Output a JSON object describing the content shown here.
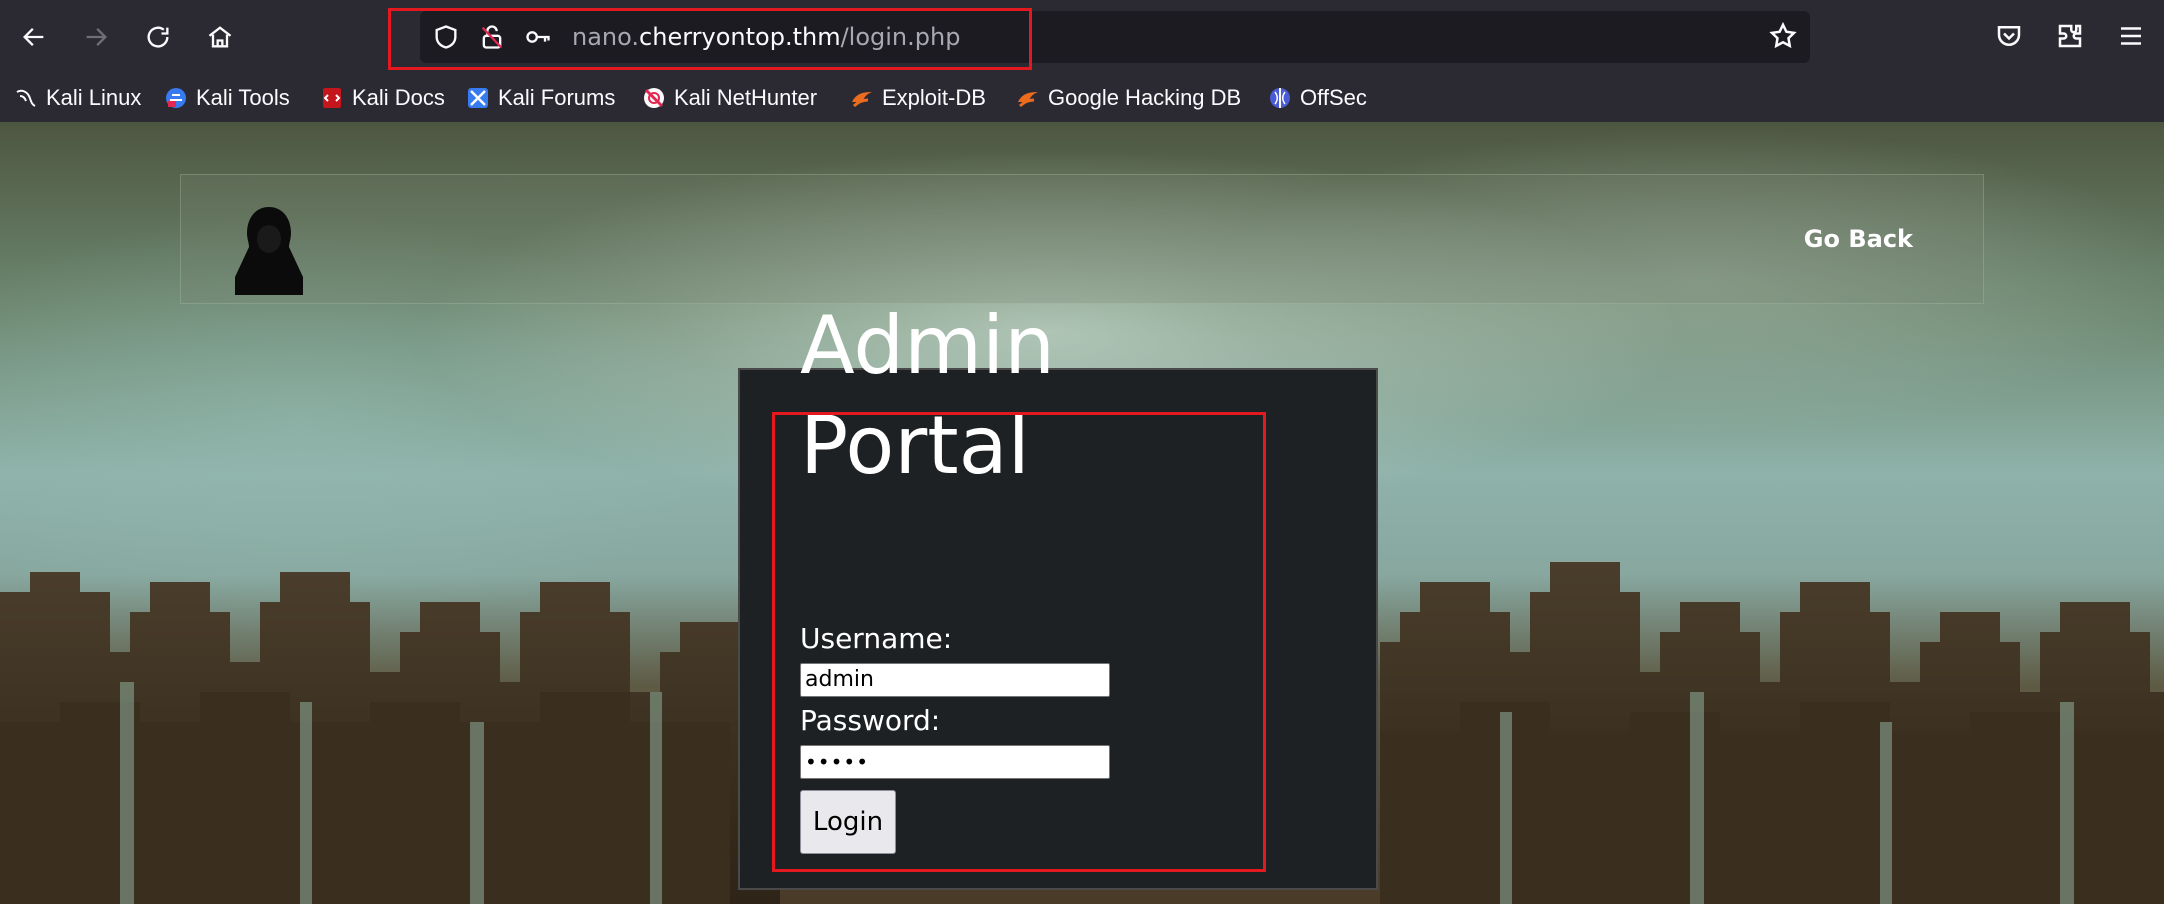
{
  "browser": {
    "url": {
      "host_prefix": "nano.",
      "domain": "cherryontop.thm",
      "path": "/login.php"
    },
    "bookmarks": [
      {
        "label": "Kali Linux",
        "icon": "kali-dragon-icon"
      },
      {
        "label": "Kali Tools",
        "icon": "kali-tools-icon"
      },
      {
        "label": "Kali Docs",
        "icon": "kali-docs-icon"
      },
      {
        "label": "Kali Forums",
        "icon": "kali-forums-icon"
      },
      {
        "label": "Kali NetHunter",
        "icon": "kali-nethunter-icon"
      },
      {
        "label": "Exploit-DB",
        "icon": "exploit-db-icon"
      },
      {
        "label": "Google Hacking DB",
        "icon": "ghdb-icon"
      },
      {
        "label": "OffSec",
        "icon": "offsec-icon"
      }
    ]
  },
  "page": {
    "nav": {
      "go_back": "Go Back"
    },
    "login": {
      "title_line1": "Admin",
      "title_line2": "Portal",
      "username_label": "Username:",
      "username_value": "admin",
      "password_label": "Password:",
      "password_value": "•••••",
      "button": "Login"
    }
  },
  "colors": {
    "annotation": "#e3191f",
    "toolbar": "#2b2a33",
    "panel": "#1e2124"
  }
}
